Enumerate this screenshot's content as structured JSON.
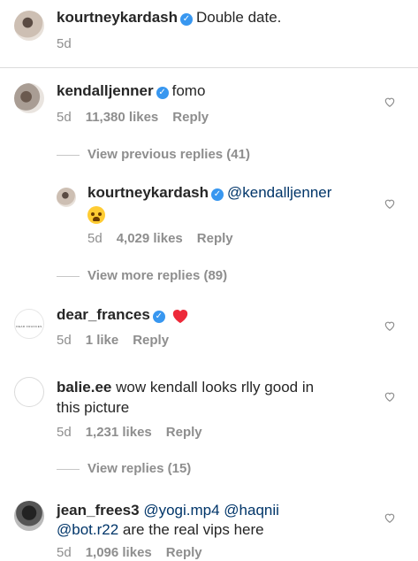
{
  "caption": {
    "username": "kourtneykardash",
    "text": "Double date.",
    "time": "5d"
  },
  "comments": [
    {
      "username": "kendalljenner",
      "text": "fomo",
      "time": "5d",
      "likes": "11,380 likes",
      "reply": "Reply"
    },
    {
      "view_label": "View previous replies (41)"
    },
    {
      "username": "kourtneykardash",
      "mention": "@kendalljenner",
      "emoji": "tired-face-emoji",
      "time": "5d",
      "likes": "4,029 likes",
      "reply": "Reply"
    },
    {
      "view_label": "View more replies (89)"
    },
    {
      "username": "dear_frances",
      "emoji": "red-heart-emoji",
      "time": "5d",
      "likes": "1 like",
      "reply": "Reply",
      "avatar_text": "DEAR FRANCES"
    },
    {
      "username": "balie.ee",
      "text_line1": "wow kendall looks rlly good in",
      "text_line2": "this picture",
      "time": "5d",
      "likes": "1,231 likes",
      "reply": "Reply"
    },
    {
      "view_label": "View replies (15)"
    },
    {
      "username": "jean_frees3",
      "mention1": "@yogi.mp4",
      "mention2": "@haqnii",
      "mention3": "@bot.r22",
      "text": "are the real vips here",
      "time": "5d",
      "likes": "1,096 likes",
      "reply": "Reply"
    }
  ],
  "colors": {
    "verified": "#3897f0",
    "mention": "#003569",
    "meta": "#8e8e8e",
    "heart_red": "#ed2939"
  }
}
